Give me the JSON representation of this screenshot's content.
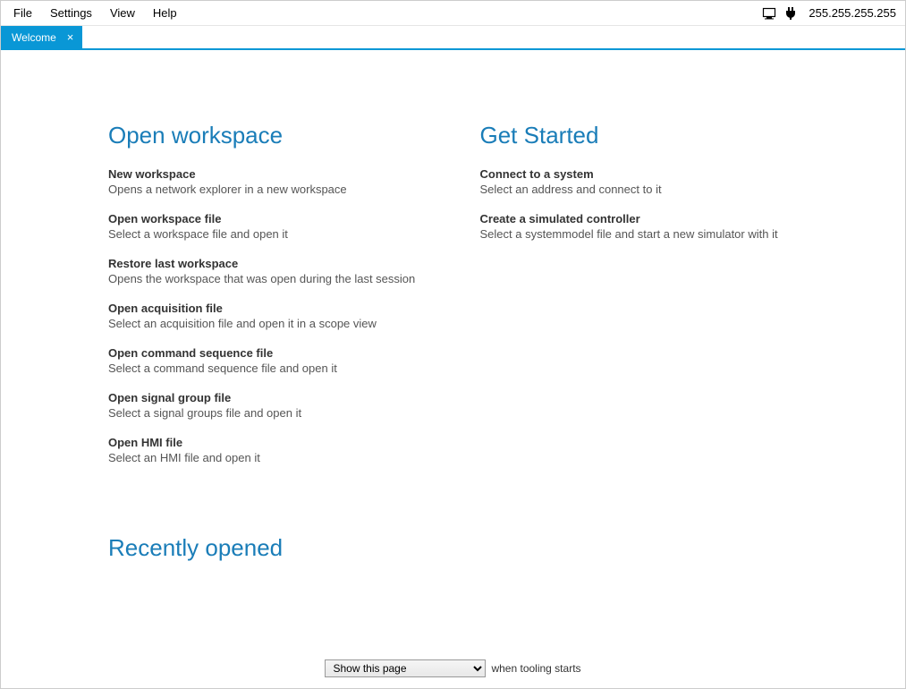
{
  "menu": {
    "items": [
      "File",
      "Settings",
      "View",
      "Help"
    ],
    "ip": "255.255.255.255"
  },
  "tabs": [
    {
      "label": "Welcome"
    }
  ],
  "open_workspace": {
    "heading": "Open workspace",
    "items": [
      {
        "title": "New workspace",
        "desc": "Opens a network explorer in a new workspace"
      },
      {
        "title": "Open workspace file",
        "desc": "Select a workspace file and open it"
      },
      {
        "title": "Restore last workspace",
        "desc": "Opens the workspace that was open during the last session"
      },
      {
        "title": "Open acquisition file",
        "desc": "Select an acquisition file and open it in a scope view"
      },
      {
        "title": "Open command sequence file",
        "desc": "Select a command sequence file and open it"
      },
      {
        "title": "Open signal group file",
        "desc": "Select a signal groups file and open it"
      },
      {
        "title": "Open HMI file",
        "desc": "Select an HMI file and open it"
      }
    ]
  },
  "get_started": {
    "heading": "Get Started",
    "items": [
      {
        "title": "Connect to a system",
        "desc": "Select an address and connect to it"
      },
      {
        "title": "Create a simulated controller",
        "desc": "Select a systemmodel file and start a new simulator with it"
      }
    ]
  },
  "recently": {
    "heading": "Recently opened"
  },
  "footer": {
    "select_value": "Show this page",
    "suffix": "when tooling starts"
  }
}
